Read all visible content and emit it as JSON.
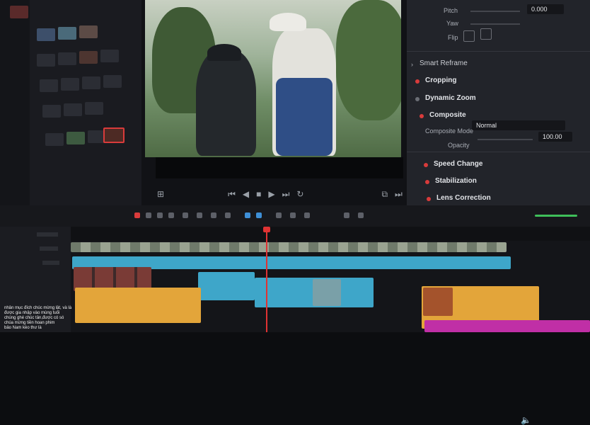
{
  "inspector": {
    "pitch_label": "Pitch",
    "yaw_label": "Yaw",
    "flip_label": "Flip",
    "pitch_value": "0.000",
    "smart_reframe": "Smart Reframe",
    "cropping": "Cropping",
    "dynamic_zoom": "Dynamic Zoom",
    "composite": "Composite",
    "composite_mode_label": "Composite Mode",
    "composite_mode_value": "Normal",
    "opacity_label": "Opacity",
    "opacity_value": "100.00",
    "speed_change": "Speed Change",
    "stabilization": "Stabilization",
    "lens_correction": "Lens Correction"
  },
  "colors": {
    "playhead": "#e03333",
    "clip_orange": "#e3a53a",
    "clip_blue": "#3ea6c9",
    "clip_pink": "#c02fa6",
    "volume_green": "#3fbf5a"
  },
  "caption": {
    "line1": "nhân mục đích chúc mừng lật, và là",
    "line2": "được gia nhập vào mùng tuối",
    "line3": "chúng ghé chúc tân,được có só",
    "line4": "chúa mừng tiền hoan phim",
    "line5": "bảo Nam kèo thư là"
  }
}
